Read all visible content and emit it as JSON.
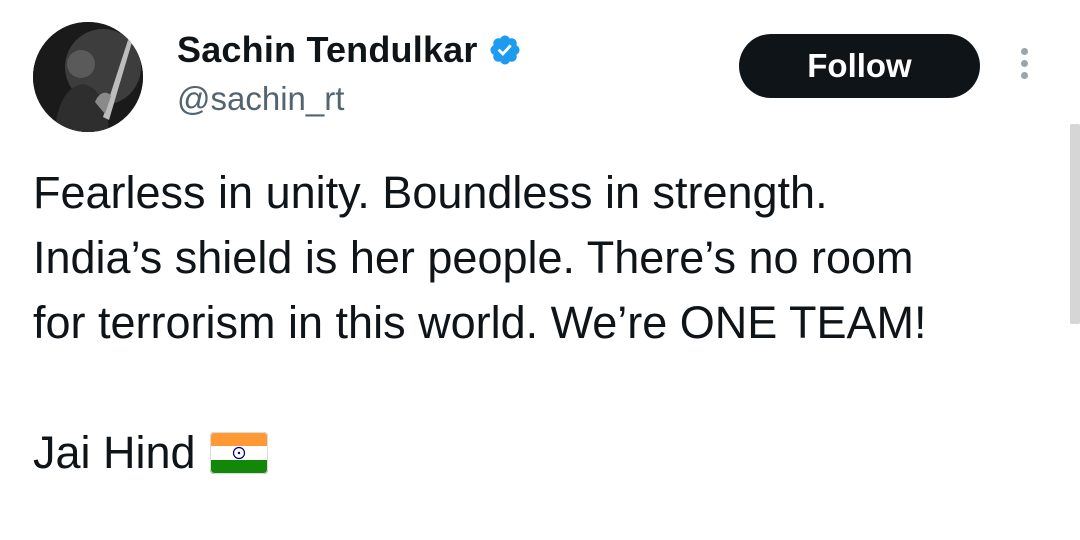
{
  "author": {
    "display_name": "Sachin Tendulkar",
    "handle": "@sachin_rt",
    "verified_icon": "verified-badge-icon",
    "verified_color": "#1d9bf0"
  },
  "actions": {
    "follow_label": "Follow",
    "more_icon": "more-vertical-icon"
  },
  "tweet": {
    "lines": [
      "Fearless in unity. Boundless in strength.",
      "India’s shield is her people. There’s no room",
      "for terrorism in this world. We’re ONE TEAM!"
    ],
    "closing": "Jai Hind",
    "closing_emoji_icon": "india-flag-icon"
  },
  "colors": {
    "text": "#0f1419",
    "secondary": "#536471",
    "button_bg": "#0f1419",
    "button_text": "#ffffff"
  }
}
